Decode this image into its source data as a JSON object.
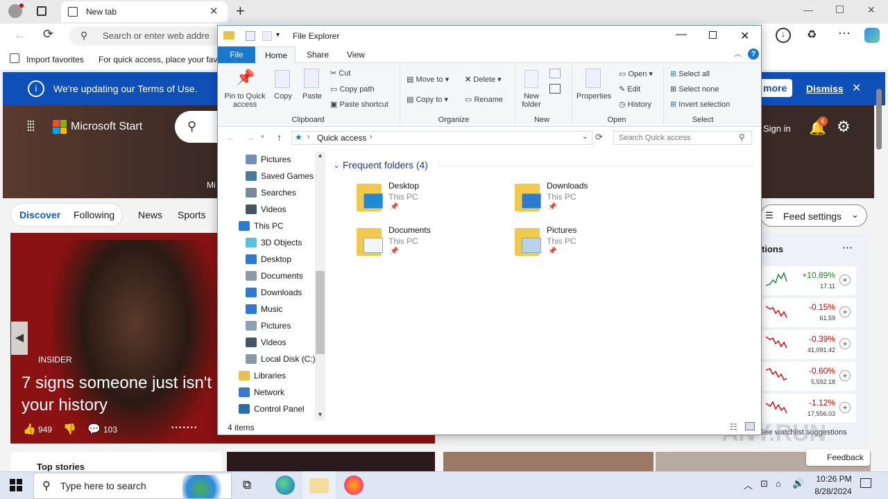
{
  "browser": {
    "tab_title": "New tab",
    "address_placeholder": "Search or enter web addre",
    "favorites": {
      "import": "Import favorites",
      "hint": "For quick access, place your favo"
    }
  },
  "msn": {
    "notice": "We're updating our Terms of Use.",
    "more": "more",
    "dismiss": "Dismiss",
    "brand": "Microsoft Start",
    "sign_in": "Sign in",
    "notif_count": "6",
    "hero_caption": "Mi",
    "nav": [
      "Discover",
      "Following",
      "News",
      "Sports"
    ],
    "feed_settings": "Feed settings",
    "story": {
      "source": "INSIDER",
      "headline_1": "7 signs someone just isn't",
      "headline_2": "your history",
      "likes": "949",
      "comments": "103"
    },
    "watchlist": {
      "title": "tions",
      "items": [
        {
          "pct": "+10.89%",
          "val": "17.11",
          "color": "#1a7f2e"
        },
        {
          "pct": "-0.15%",
          "val": "61.59",
          "color": "#c00"
        },
        {
          "pct": "-0.39%",
          "val": "41,091.42",
          "color": "#c00"
        },
        {
          "pct": "-0.60%",
          "val": "5,592.18",
          "color": "#c00"
        },
        {
          "pct": "-1.12%",
          "val": "17,556.03",
          "color": "#c00"
        }
      ],
      "suggestions": "See watchlist suggestions"
    },
    "top_stories": "Top stories",
    "feedback": "Feedback",
    "watermark": "ANY.RUN"
  },
  "explorer": {
    "title": "File Explorer",
    "tabs": [
      "File",
      "Home",
      "Share",
      "View"
    ],
    "clipboard": {
      "pin": "Pin to Quick access",
      "copy": "Copy",
      "paste": "Paste",
      "cut": "Cut",
      "copy_path": "Copy path",
      "paste_shortcut": "Paste shortcut",
      "group": "Clipboard"
    },
    "organize": {
      "move_to": "Move to",
      "copy_to": "Copy to",
      "delete": "Delete",
      "rename": "Rename",
      "group": "Organize"
    },
    "new": {
      "new_folder": "New folder",
      "group": "New"
    },
    "open": {
      "properties": "Properties",
      "open": "Open",
      "edit": "Edit",
      "history": "History",
      "group": "Open"
    },
    "select": {
      "select_all": "Select all",
      "select_none": "Select none",
      "invert": "Invert selection",
      "group": "Select"
    },
    "path": "Quick access",
    "search_placeholder": "Search Quick access",
    "tree": [
      "Pictures",
      "Saved Games",
      "Searches",
      "Videos",
      "This PC",
      "3D Objects",
      "Desktop",
      "Documents",
      "Downloads",
      "Music",
      "Pictures",
      "Videos",
      "Local Disk (C:)",
      "Libraries",
      "Network",
      "Control Panel"
    ],
    "section": "Frequent folders (4)",
    "folders": [
      {
        "name": "Desktop",
        "location": "This PC"
      },
      {
        "name": "Downloads",
        "location": "This PC"
      },
      {
        "name": "Documents",
        "location": "This PC"
      },
      {
        "name": "Pictures",
        "location": "This PC"
      }
    ],
    "status": "4 items"
  },
  "taskbar": {
    "search": "Type here to search",
    "time": "10:26 PM",
    "date": "8/28/2024"
  }
}
